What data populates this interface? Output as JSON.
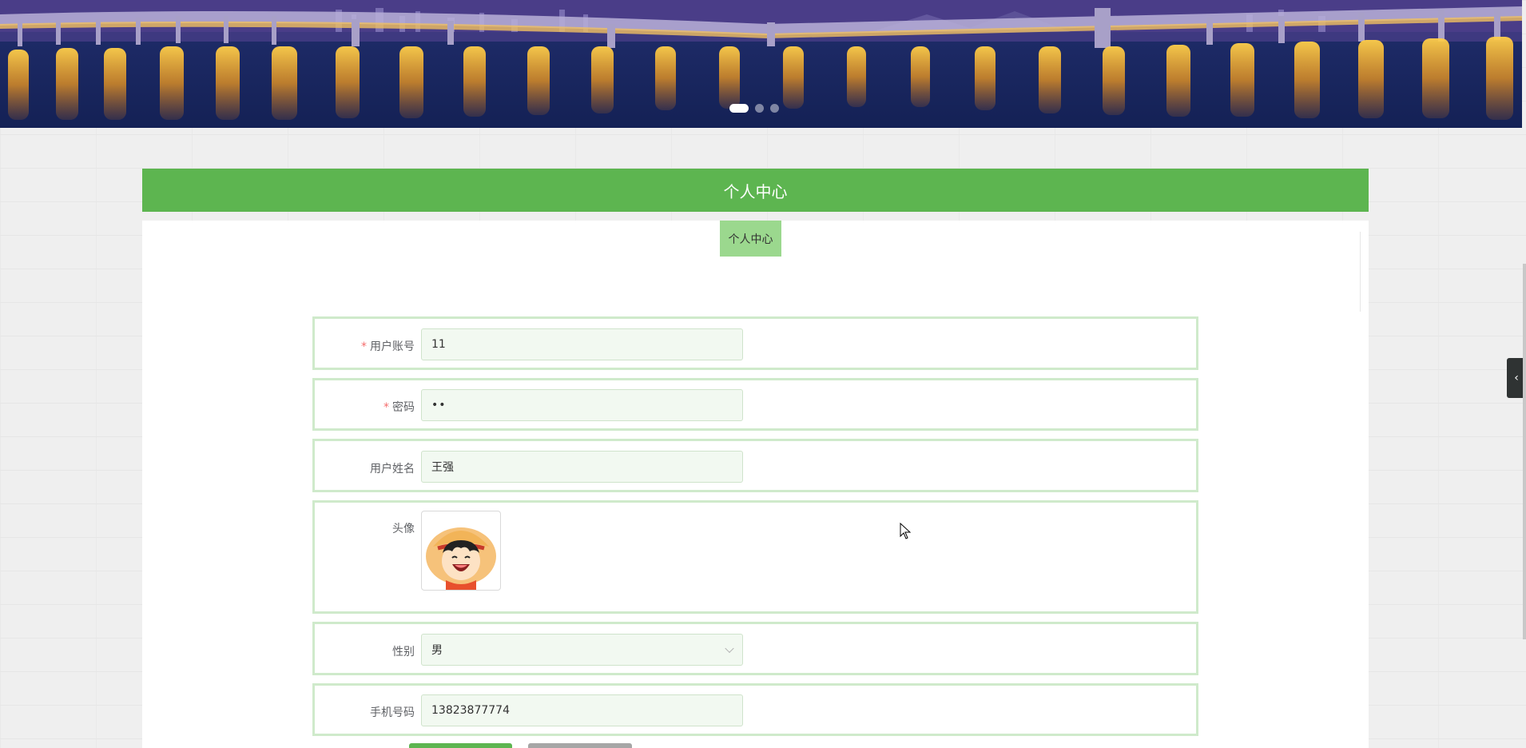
{
  "banner": {
    "carousel_dots": 3,
    "active_dot": 1
  },
  "panel": {
    "title": "个人中心",
    "tab_label": "个人中心"
  },
  "form": {
    "username": {
      "label": "用户账号",
      "required": true,
      "value": "11"
    },
    "password": {
      "label": "密码",
      "required": true,
      "value": "••"
    },
    "fullname": {
      "label": "用户姓名",
      "required": false,
      "value": "王强"
    },
    "avatar": {
      "label": "头像",
      "icon": "cartoon-avatar-icon"
    },
    "gender": {
      "label": "性别",
      "value": "男"
    },
    "phone": {
      "label": "手机号码",
      "value": "13823877774"
    },
    "required_mark": "*"
  },
  "colors": {
    "header_green": "#5db550",
    "tab_green": "#9bd88e",
    "row_border": "#cfeacb",
    "field_bg": "#f2f9f1",
    "required_red": "#f56c6c"
  },
  "icons": {
    "side_toggle": "chevron-left-icon",
    "select_arrow": "chevron-down-icon",
    "cursor": "mouse-pointer-icon"
  }
}
